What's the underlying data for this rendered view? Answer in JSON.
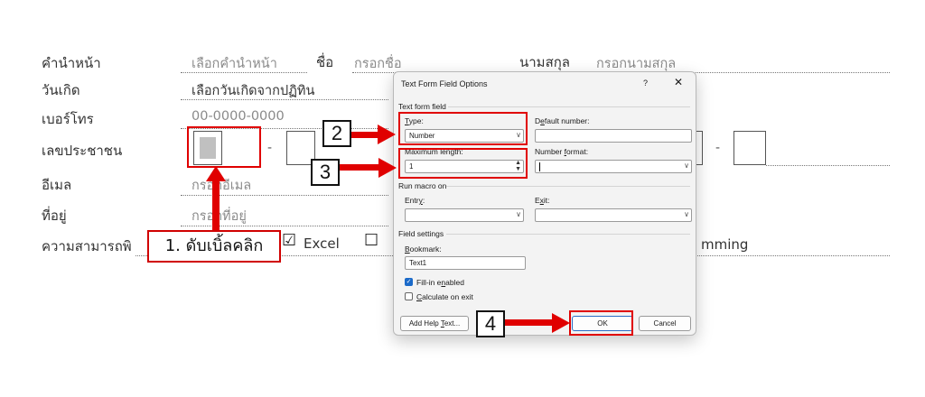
{
  "form": {
    "title_label": "คำนำหน้า",
    "title_placeholder": "เลือกคำนำหน้า",
    "firstname_label": "ชื่อ",
    "firstname_placeholder": "กรอกชื่อ",
    "lastname_label": "นามสกุล",
    "lastname_placeholder": "กรอกนามสกุล",
    "birthdate_label": "วันเกิด",
    "birthdate_placeholder": "เลือกวันเกิดจากปฏิทิน",
    "phone_label": "เบอร์โทร",
    "phone_placeholder": "00-0000-0000",
    "idcard_label": "เลขประชาชน",
    "idcard_dash": "-",
    "email_label": "อีเมล",
    "email_placeholder": "กรอกอีเมล",
    "address_label": "ที่อยู่",
    "address_placeholder": "กรอกที่อยู่",
    "skills_label": "ความสามารถพิ",
    "skill_excel": "Excel",
    "skill_check_excel": "☑",
    "skill_check_next": "☐",
    "skill_programming_tail": "mming"
  },
  "dialog": {
    "title": "Text Form Field Options",
    "help": "?",
    "close": "✕",
    "section_text_form_field": "Text form field",
    "type_label": "Type:",
    "type_value": "Number",
    "default_label": "Default number:",
    "default_value": "",
    "maxlen_label": "Maximum length:",
    "maxlen_value": "1",
    "numfmt_label": "Number format:",
    "numfmt_value": "",
    "section_macro": "Run macro on",
    "entry_label": "Entry:",
    "exit_label": "Exit:",
    "section_field_settings": "Field settings",
    "bookmark_label": "Bookmark:",
    "bookmark_value": "Text1",
    "fill_in_label": "Fill-in enabled",
    "fill_in_checked": true,
    "calc_label": "Calculate on exit",
    "calc_checked": false,
    "add_help_button": "Add Help Text...",
    "ok_button": "OK",
    "cancel_button": "Cancel"
  },
  "annotations": {
    "step1": "1. ดับเบิ้ลคลิก",
    "step2": "2",
    "step3": "3",
    "step4": "4"
  },
  "colors": {
    "annotation_red": "#e00000",
    "dialog_bg": "#f3f3f3",
    "checkbox_blue": "#1b6ac9"
  }
}
